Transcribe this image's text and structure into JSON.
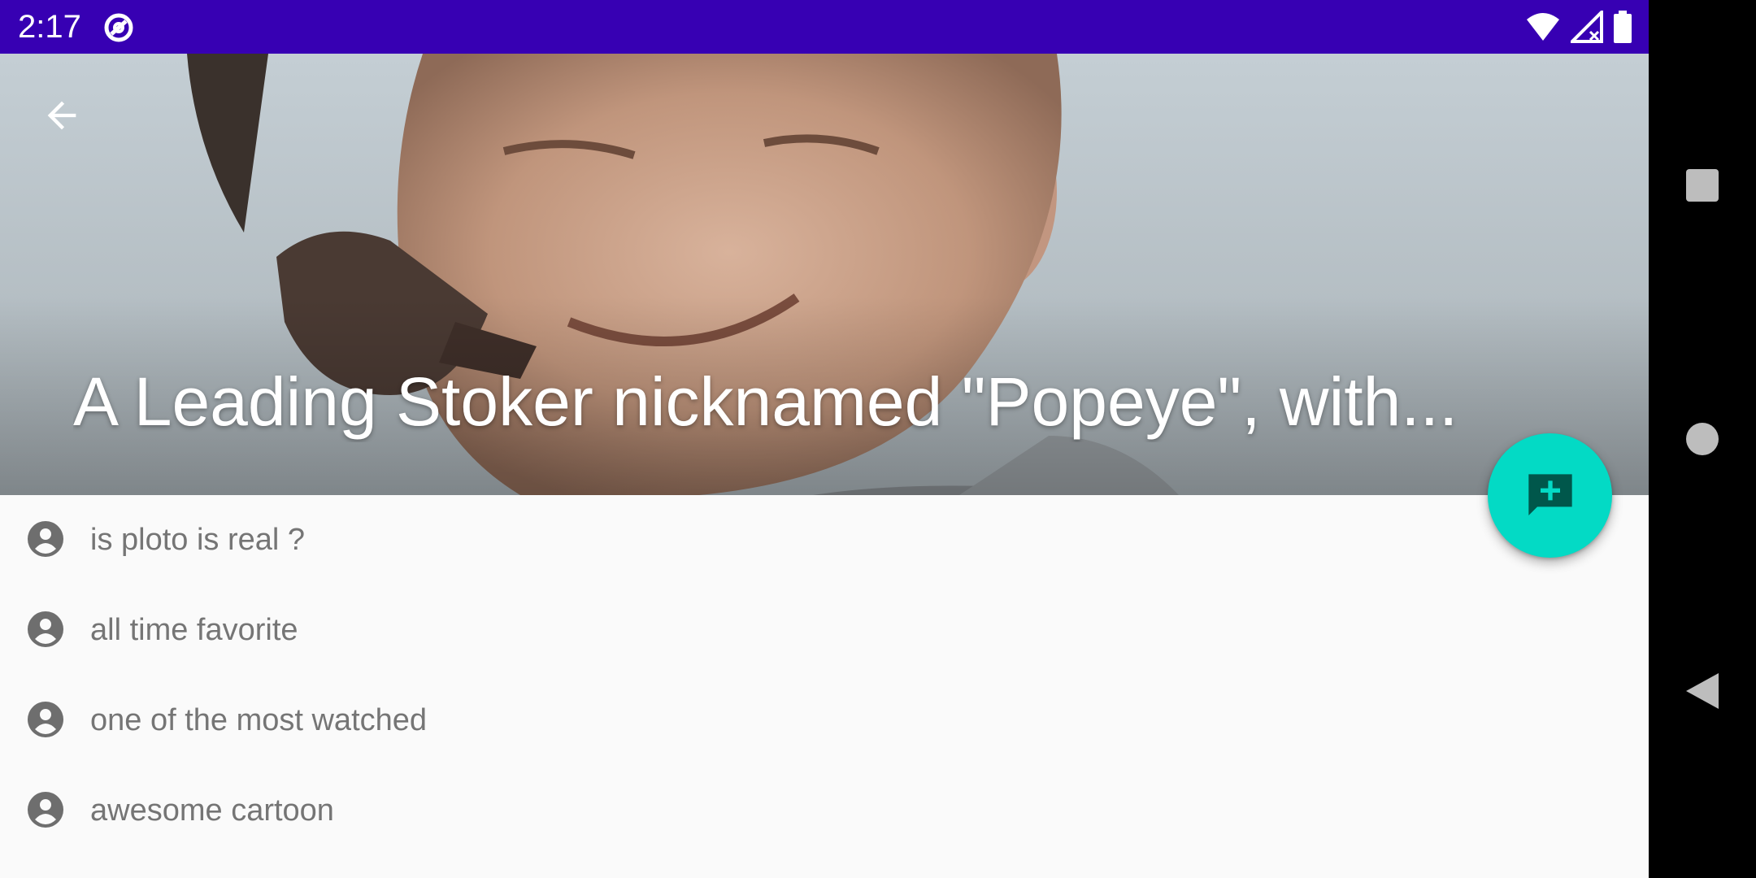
{
  "status_bar": {
    "time": "2:17",
    "icons": [
      "sync-icon",
      "wifi-icon",
      "signal-icon",
      "battery-icon"
    ],
    "background": "#3700b3"
  },
  "header": {
    "title": "A Leading Stoker nicknamed \"Popeye\", with..."
  },
  "fab": {
    "icon": "add-comment-icon",
    "color": "#03dac5"
  },
  "comments": [
    {
      "text": "is ploto is real ?",
      "icon": "account-circle-icon"
    },
    {
      "text": "all time favorite",
      "icon": "account-circle-icon"
    },
    {
      "text": "one of the most watched",
      "icon": "account-circle-icon"
    },
    {
      "text": "awesome cartoon",
      "icon": "account-circle-icon"
    }
  ],
  "nav_bar": {
    "buttons": [
      "recents-icon",
      "home-icon",
      "back-icon"
    ]
  }
}
